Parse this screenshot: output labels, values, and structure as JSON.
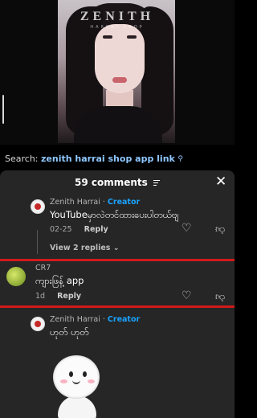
{
  "video": {
    "brand_text": "ZENITH",
    "brand_subtext": "HARRAI SHOP"
  },
  "search": {
    "prefix": "Search:",
    "query": "zenith harrai shop app link"
  },
  "comments_sheet": {
    "count_label": "59 comments",
    "comments": [
      {
        "username": "Zenith Harrai",
        "separator": " · ",
        "badge": "Creator",
        "text": "YouTubeမှာလဲတင်ထားပေးပါတယ်ဗျ",
        "timestamp": "02-25",
        "reply_label": "Reply",
        "view_replies": "View 2 replies"
      },
      {
        "username": "CR7",
        "text": "ကျားဖြန့် app",
        "timestamp": "1d",
        "reply_label": "Reply"
      },
      {
        "username": "Zenith Harrai",
        "separator": " · ",
        "badge": "Creator",
        "text": "ဟုတ် ဟုတ်"
      }
    ]
  },
  "colors": {
    "accent": "#1aa3ff",
    "search_link": "#8fc7ff",
    "highlight": "#d11a1a",
    "sheet_bg": "#262626"
  }
}
